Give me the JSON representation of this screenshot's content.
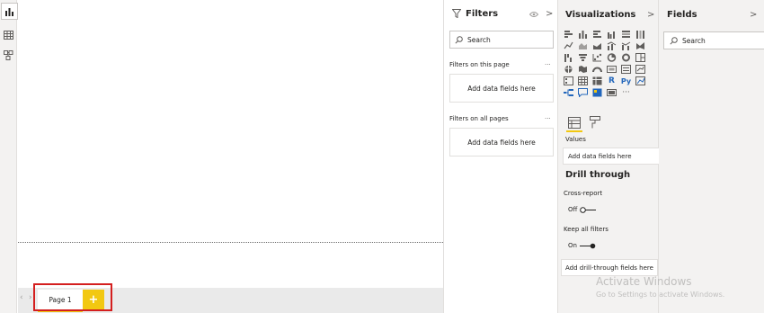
{
  "filters": {
    "title": "Filters",
    "search_placeholder": "Search",
    "on_this_page_label": "Filters on this page",
    "on_this_page_drop": "Add data fields here",
    "on_all_pages_label": "Filters on all pages",
    "on_all_pages_drop": "Add data fields here",
    "more": "...",
    "arrow": ">"
  },
  "visualizations": {
    "title": "Visualizations",
    "arrow": ">",
    "more": "···",
    "r_label": "R",
    "py_label": "Py",
    "values_label": "Values",
    "values_drop": "Add data fields here",
    "drill_through_title": "Drill through",
    "cross_report_label": "Cross-report",
    "cross_report_state": "Off",
    "keep_all_filters_label": "Keep all filters",
    "keep_all_filters_state": "On",
    "drill_drop": "Add drill-through fields here"
  },
  "fields": {
    "title": "Fields",
    "arrow": ">",
    "search_placeholder": "Search"
  },
  "pages": {
    "tabs": [
      "Page 1"
    ],
    "add_label": "+"
  },
  "watermark": {
    "line1": "Activate Windows",
    "line2": "Go to Settings to activate Windows."
  },
  "colors": {
    "accent": "#f2c811",
    "highlight": "#d41f1f",
    "pane_bg": "#f3f2f1"
  }
}
